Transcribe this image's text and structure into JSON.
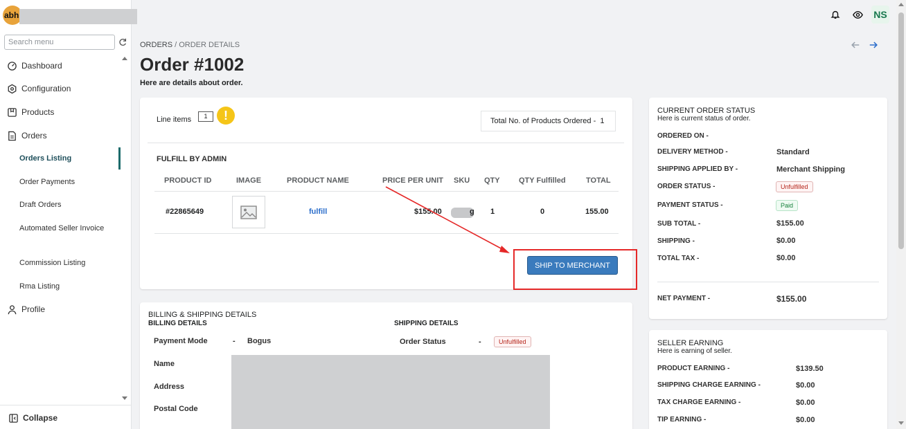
{
  "brand": {
    "logo_text": "abh"
  },
  "sidebar": {
    "search_placeholder": "Search menu",
    "items": [
      {
        "label": "Dashboard",
        "icon": "gauge-icon"
      },
      {
        "label": "Configuration",
        "icon": "settings-icon"
      },
      {
        "label": "Products",
        "icon": "box-icon"
      },
      {
        "label": "Orders",
        "icon": "document-icon"
      },
      {
        "label": "Profile",
        "icon": "user-icon"
      }
    ],
    "order_subitems": [
      "Orders Listing",
      "Order Payments",
      "Draft Orders",
      "Automated Seller Invoice",
      "Commission Listing",
      "Rma Listing"
    ],
    "active_subitem": "Orders Listing",
    "collapse_label": "Collapse"
  },
  "header": {
    "avatar_initials": "NS"
  },
  "page": {
    "breadcrumb_1": "ORDERS",
    "breadcrumb_sep": " / ",
    "breadcrumb_2": "ORDER DETAILS",
    "title": "Order #1002",
    "subtitle": "Here are details about order."
  },
  "line_items": {
    "label": "Line items",
    "count": "1",
    "warn_symbol": "!",
    "total_ordered_label": "Total No. of Products Ordered -",
    "total_ordered_value": "1",
    "section_title": "FULFILL BY ADMIN",
    "columns": [
      "PRODUCT ID",
      "IMAGE",
      "PRODUCT NAME",
      "PRICE PER UNIT",
      "SKU",
      "QTY",
      "QTY Fulfilled",
      "TOTAL"
    ],
    "rows": [
      {
        "product_id": "#22865649",
        "product_name": "fulfill",
        "price": "$155.00",
        "sku_visible": "g",
        "qty": "1",
        "qty_fulfilled": "0",
        "total": "155.00"
      }
    ],
    "action_button": "SHIP TO MERCHANT"
  },
  "billing": {
    "title": "BILLING & SHIPPING DETAILS",
    "billing_heading": "BILLING DETAILS",
    "shipping_heading": "SHIPPING DETAILS",
    "payment_mode_label": "Payment Mode",
    "payment_mode_sep": "-",
    "payment_mode_value": "Bogus",
    "order_status_label": "Order Status",
    "order_status_sep": "-",
    "order_status_value": "Unfulfilled",
    "name_label": "Name",
    "address_label": "Address",
    "postal_label": "Postal Code"
  },
  "order_status": {
    "title": "CURRENT ORDER STATUS",
    "subtitle": "Here is current status of order.",
    "ordered_on_label": "ORDERED ON -",
    "delivery_label": "DELIVERY METHOD -",
    "delivery_value": "Standard",
    "shipping_applied_label": "SHIPPING APPLIED BY -",
    "shipping_applied_value": "Merchant Shipping",
    "order_status_label": "ORDER STATUS -",
    "order_status_value": "Unfulfilled",
    "payment_status_label": "PAYMENT STATUS -",
    "payment_status_value": "Paid",
    "sub_total_label": "SUB TOTAL -",
    "sub_total_value": "$155.00",
    "shipping_label": "SHIPPING -",
    "shipping_value": "$0.00",
    "total_tax_label": "TOTAL TAX -",
    "total_tax_value": "$0.00",
    "net_payment_label": "NET PAYMENT -",
    "net_payment_value": "$155.00"
  },
  "seller_earning": {
    "title": "SELLER EARNING",
    "subtitle": "Here is earning of seller.",
    "product_earning_label": "PRODUCT EARNING -",
    "product_earning_value": "$139.50",
    "shipping_charge_label": "SHIPPING CHARGE EARNING -",
    "shipping_charge_value": "$0.00",
    "tax_charge_label": "TAX CHARGE EARNING -",
    "tax_charge_value": "$0.00",
    "tip_label": "TIP EARNING -",
    "tip_value": "$0.00"
  },
  "colors": {
    "accent": "#3a7bbd",
    "annotation": "#e52828",
    "active_nav": "#1c6b6b"
  }
}
